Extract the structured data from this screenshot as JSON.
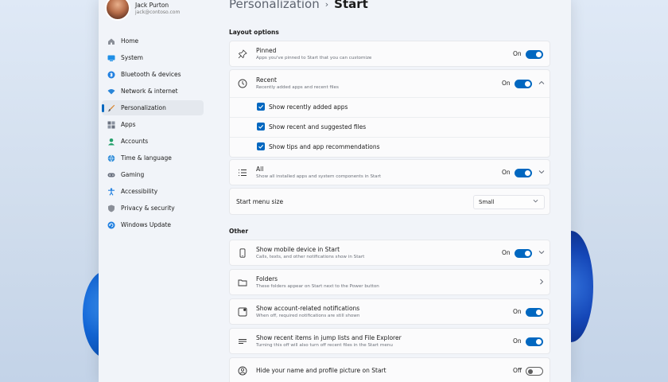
{
  "profile": {
    "name": "Jack Purton",
    "email": "jack@contoso.com"
  },
  "sidebar": {
    "items": [
      {
        "label": "Home",
        "icon": "home-icon"
      },
      {
        "label": "System",
        "icon": "system-icon"
      },
      {
        "label": "Bluetooth & devices",
        "icon": "bluetooth-icon"
      },
      {
        "label": "Network & internet",
        "icon": "wifi-icon"
      },
      {
        "label": "Personalization",
        "icon": "brush-icon",
        "selected": true
      },
      {
        "label": "Apps",
        "icon": "apps-icon"
      },
      {
        "label": "Accounts",
        "icon": "accounts-icon"
      },
      {
        "label": "Time & language",
        "icon": "globe-icon"
      },
      {
        "label": "Gaming",
        "icon": "gamepad-icon"
      },
      {
        "label": "Accessibility",
        "icon": "accessibility-icon"
      },
      {
        "label": "Privacy & security",
        "icon": "shield-icon"
      },
      {
        "label": "Windows Update",
        "icon": "update-icon"
      }
    ]
  },
  "breadcrumb": {
    "parent": "Personalization",
    "separator": "›",
    "current": "Start"
  },
  "layout_options": {
    "title": "Layout options",
    "pinned": {
      "title": "Pinned",
      "desc": "Apps you've pinned to Start that you can customize",
      "state": "On"
    },
    "recent": {
      "title": "Recent",
      "desc": "Recently added apps and recent files",
      "state": "On",
      "options": [
        "Show recently added apps",
        "Show recent and suggested files",
        "Show tips and app recommendations"
      ]
    },
    "all": {
      "title": "All",
      "desc": "Show all installed apps and system components in Start",
      "state": "On"
    },
    "menu_size": {
      "label": "Start menu size",
      "value": "Small"
    }
  },
  "other": {
    "title": "Other",
    "mobile": {
      "title": "Show mobile device in Start",
      "desc": "Calls, texts, and other notifications show in Start",
      "state": "On"
    },
    "folders": {
      "title": "Folders",
      "desc": "These folders appear on Start next to the Power button"
    },
    "account_notifications": {
      "title": "Show account-related notifications",
      "desc": "When off, required notifications are still shown",
      "state": "On"
    },
    "jump_lists": {
      "title": "Show recent items in jump lists and File Explorer",
      "desc": "Turning this off will also turn off recent files in the Start menu",
      "state": "On"
    },
    "hide_profile": {
      "title": "Hide your name and profile picture on Start",
      "state": "Off"
    }
  },
  "colors": {
    "accent": "#0067c0",
    "selected_bg": "#e4e8ee"
  }
}
